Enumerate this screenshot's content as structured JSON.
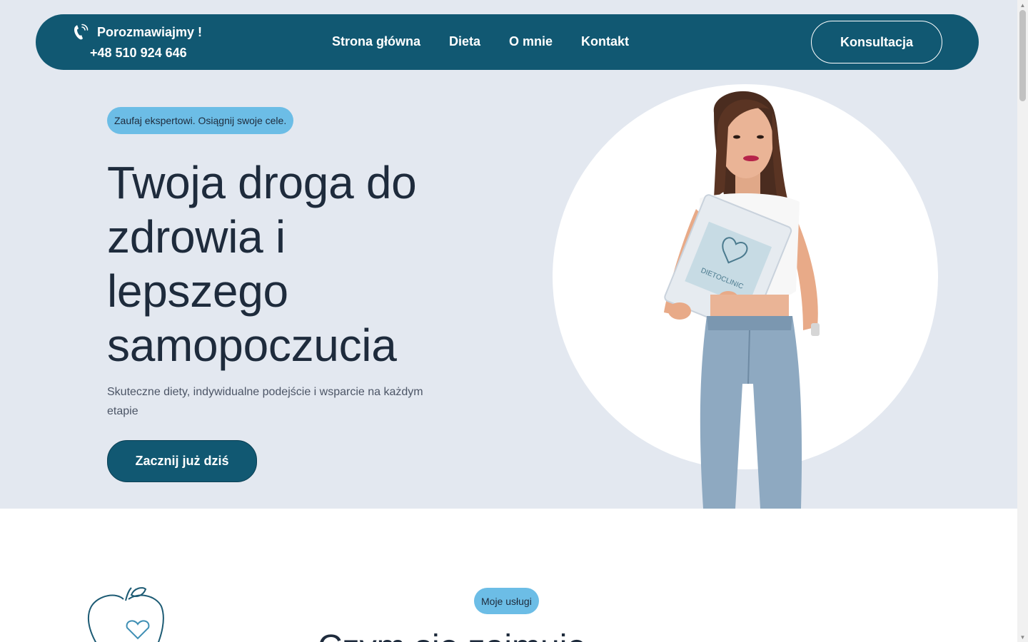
{
  "header": {
    "contact_label": "Porozmawiajmy !",
    "phone": "+48 510 924 646",
    "phone_icon": "phone-ringing-icon",
    "nav": [
      "Strona główna",
      "Dieta",
      "O mnie",
      "Kontakt"
    ],
    "cta": "Konsultacja"
  },
  "hero": {
    "badge": "Zaufaj ekspertowi. Osiągnij swoje cele.",
    "title": "Twoja droga do zdrowia i lepszego samopoczucia",
    "subtitle": "Skuteczne diety, indywidualne podejście i wsparcie na każdym etapie",
    "cta": "Zacznij już dziś",
    "portrait_folder_text": "DIETOCLINIC"
  },
  "services": {
    "badge": "Moje usługi",
    "title": "Czym się zajmuję"
  },
  "colors": {
    "primary": "#115872",
    "accent": "#6cbde6",
    "hero_background": "#e3e8f0",
    "text_dark": "#1e2b3c"
  }
}
